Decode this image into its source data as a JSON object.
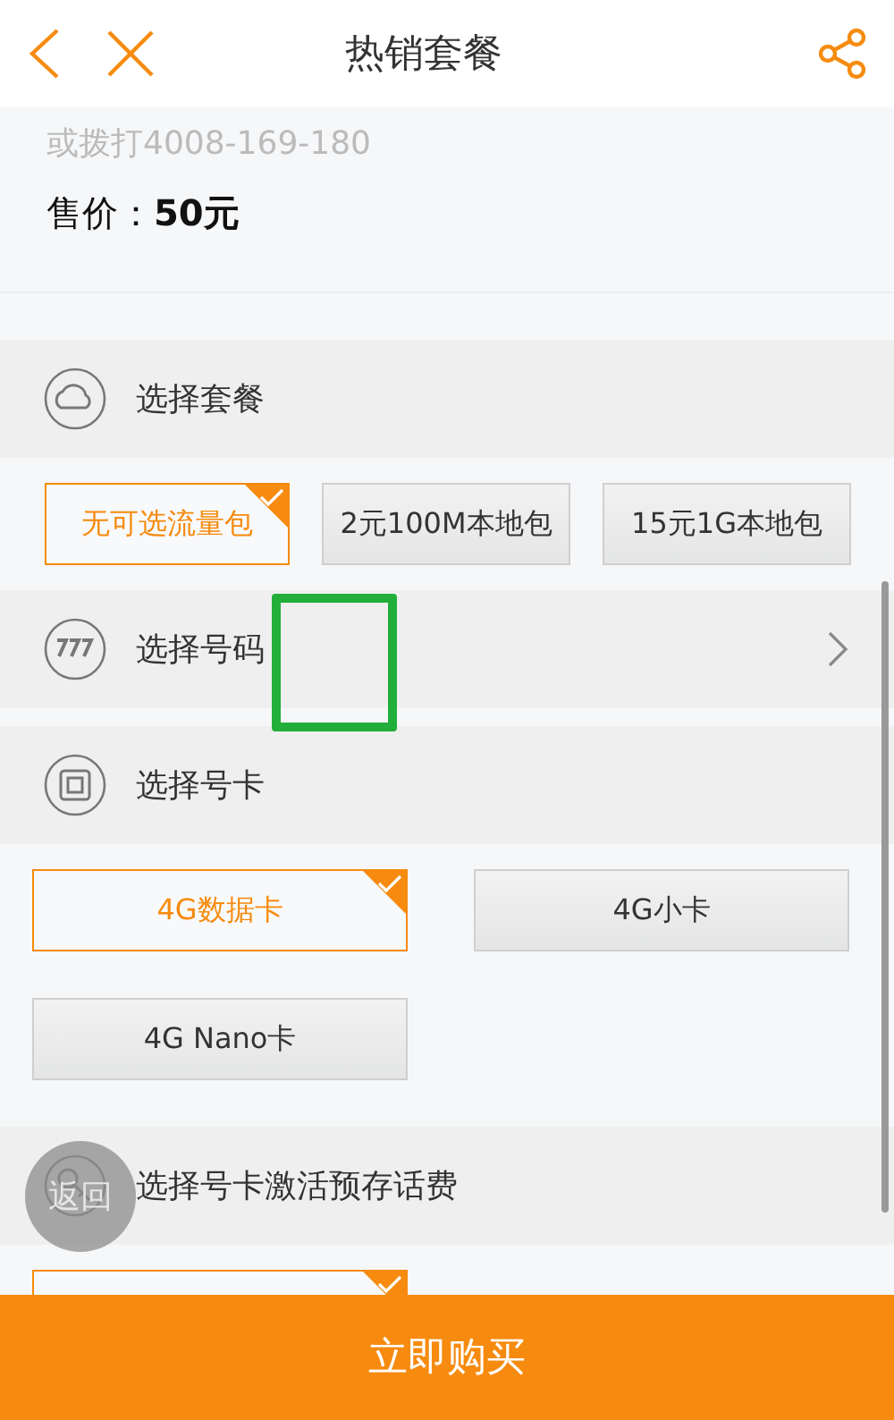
{
  "header": {
    "title": "热销套餐"
  },
  "description": "或拨打4008-169-180",
  "price": "售价：**50元**",
  "sections": [
    {
      "title": "选择套餐",
      "kind": "row",
      "options": [
        {
          "label": "无可选流量包",
          "selected": true
        },
        {
          "label": "2元100M本地包",
          "selected": false
        },
        {
          "label": "15元1G本地包",
          "selected": false
        }
      ]
    },
    {
      "title": "选择号码",
      "kind": "link"
    },
    {
      "title": "选择号卡",
      "kind": "grid",
      "options": [
        {
          "label": "4G数据卡",
          "selected": true
        },
        {
          "label": "4G小卡",
          "selected": false
        },
        {
          "label": "4G Nano卡",
          "selected": false
        }
      ]
    },
    {
      "title": "选择号卡激活预存话费",
      "kind": "grid",
      "options": [
        {
          "selected": true
        }
      ]
    }
  ],
  "float_button": "返回",
  "buy_button": "立即购买"
}
